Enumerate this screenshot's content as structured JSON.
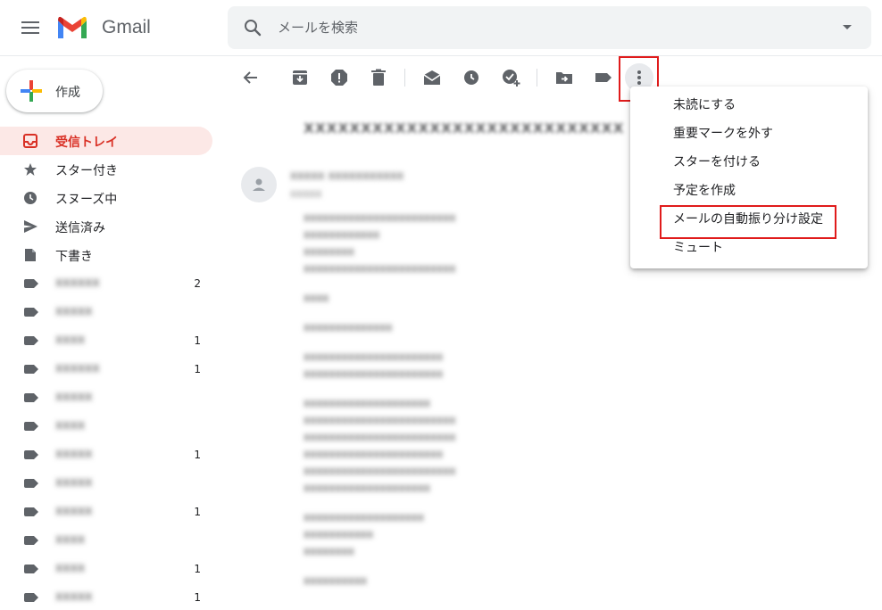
{
  "header": {
    "app_name": "Gmail",
    "search_placeholder": "メールを検索"
  },
  "compose": {
    "label": "作成"
  },
  "sidebar": {
    "items": [
      {
        "label": "受信トレイ",
        "icon": "inbox-icon",
        "count": "",
        "active": true
      },
      {
        "label": "スター付き",
        "icon": "star-icon",
        "count": ""
      },
      {
        "label": "スヌーズ中",
        "icon": "clock-icon",
        "count": ""
      },
      {
        "label": "送信済み",
        "icon": "send-icon",
        "count": ""
      },
      {
        "label": "下書き",
        "icon": "draft-icon",
        "count": ""
      },
      {
        "label": "xxxxxx",
        "icon": "label-icon",
        "count": "2"
      },
      {
        "label": "xxxxx",
        "icon": "label-icon",
        "count": ""
      },
      {
        "label": "xxxx",
        "icon": "label-icon",
        "count": "1"
      },
      {
        "label": "xxxxxx",
        "icon": "label-icon",
        "count": "1"
      },
      {
        "label": "xxxxx",
        "icon": "label-icon",
        "count": ""
      },
      {
        "label": "xxxx",
        "icon": "label-icon",
        "count": ""
      },
      {
        "label": "xxxxx",
        "icon": "label-icon",
        "count": "1"
      },
      {
        "label": "xxxxx",
        "icon": "label-icon",
        "count": ""
      },
      {
        "label": "xxxxx",
        "icon": "label-icon",
        "count": "1"
      },
      {
        "label": "xxxx",
        "icon": "label-icon",
        "count": ""
      },
      {
        "label": "xxxx",
        "icon": "label-icon",
        "count": "1"
      },
      {
        "label": "xxxxx",
        "icon": "label-icon",
        "count": "1"
      }
    ]
  },
  "toolbar": {
    "buttons": [
      "back-icon",
      "archive-icon",
      "report-spam-icon",
      "delete-icon",
      "mark-unread-icon",
      "snooze-icon",
      "add-task-icon",
      "move-to-icon",
      "label-icon",
      "more-icon"
    ]
  },
  "message": {
    "subject": "xxxxxxxxxxxxxxxxxxxxxxxxxxxx",
    "sender": "xxxxx xxxxxxxxxxx",
    "to": "xxxxx",
    "body": [
      "xxxxxxxxxxxxxxxxxxxxxxxx",
      "xxxxxxxxxxxx",
      "xxxxxxxx",
      "xxxxxxxxxxxxxxxxxxxxxxxx",
      "",
      "xxxx",
      "",
      "xxxxxxxxxxxxxx",
      "",
      "xxxxxxxxxxxxxxxxxxxxxx",
      "xxxxxxxxxxxxxxxxxxxxxx",
      "",
      "xxxxxxxxxxxxxxxxxxxx",
      "xxxxxxxxxxxxxxxxxxxxxxxx",
      "xxxxxxxxxxxxxxxxxxxxxxxx",
      "xxxxxxxxxxxxxxxxxxxxxx",
      "xxxxxxxxxxxxxxxxxxxxxxxx",
      "xxxxxxxxxxxxxxxxxxxx",
      "",
      "xxxxxxxxxxxxxxxxxxx",
      "xxxxxxxxxxx",
      "xxxxxxxx",
      "",
      "xxxxxxxxxx"
    ]
  },
  "menu": {
    "items": [
      {
        "label": "未読にする"
      },
      {
        "label": "重要マークを外す"
      },
      {
        "label": "スターを付ける"
      },
      {
        "label": "予定を作成"
      },
      {
        "label": "メールの自動振り分け設定",
        "highlighted": true
      },
      {
        "label": "ミュート"
      }
    ]
  },
  "colors": {
    "accent_red": "#d93025",
    "active_bg": "#fce8e6",
    "annotation_red": "#e01b1b"
  }
}
